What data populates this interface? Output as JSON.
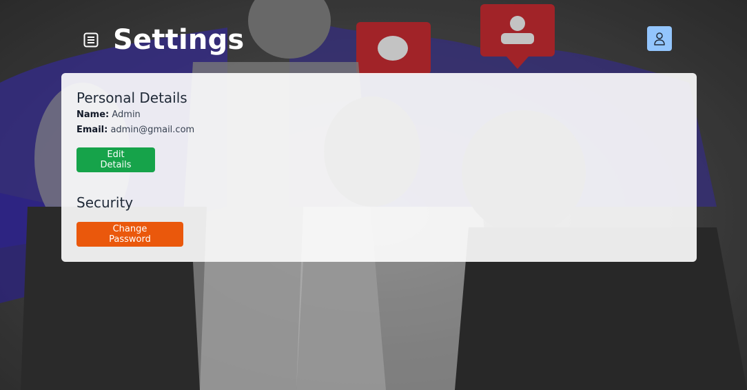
{
  "header": {
    "title": "Settings",
    "menu_icon": "document-list-icon",
    "profile_icon": "user-icon"
  },
  "personal_details": {
    "title": "Personal Details",
    "name_label": "Name:",
    "name_value": "Admin",
    "email_label": "Email:",
    "email_value": "admin@gmail.com",
    "edit_button_label": "Edit Details"
  },
  "security": {
    "title": "Security",
    "change_password_label": "Change Password"
  },
  "colors": {
    "edit_button": "#16a34a",
    "change_password_button": "#ea580c",
    "profile_button": "#93c5fd"
  }
}
